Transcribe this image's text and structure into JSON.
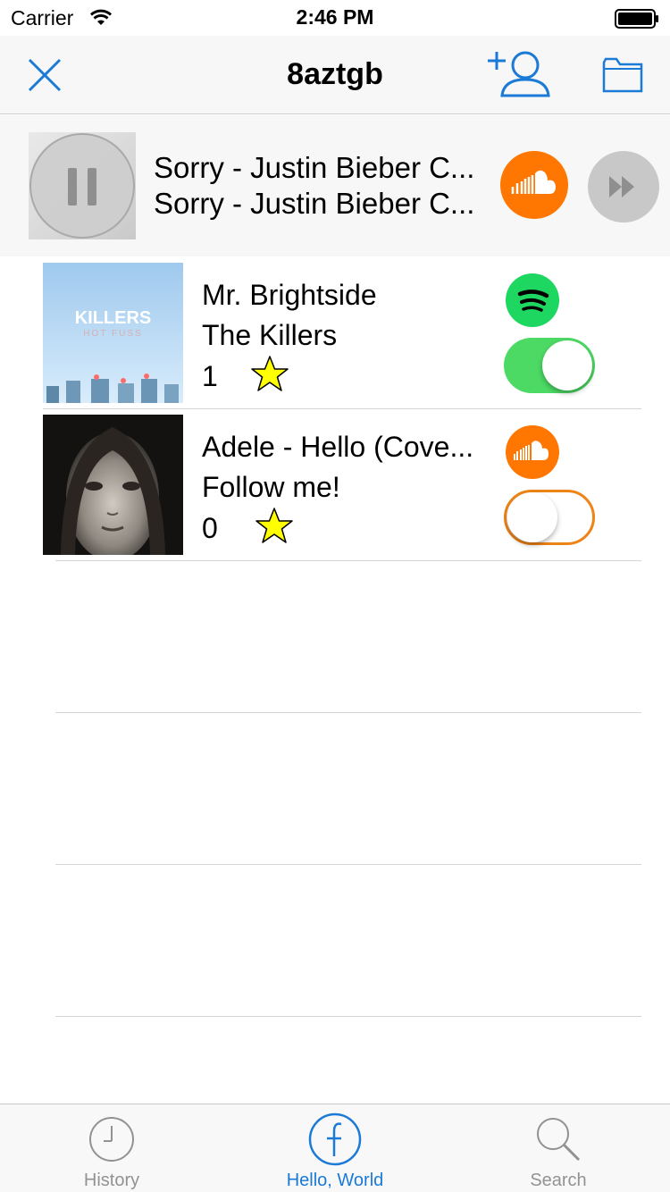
{
  "status_bar": {
    "carrier": "Carrier",
    "time": "2:46 PM"
  },
  "nav": {
    "title": "8aztgb",
    "close_icon": "close-icon",
    "add_user_icon": "add-user-icon",
    "folder_icon": "folder-icon"
  },
  "now_playing": {
    "title": "Sorry - Justin Bieber C...",
    "subtitle": "Sorry - Justin Bieber C...",
    "service_icon": "soundcloud-icon",
    "state": "playing"
  },
  "tracks": [
    {
      "title": "Mr. Brightside",
      "artist": "The Killers",
      "votes": "1",
      "service": "spotify",
      "enabled": true,
      "art_text": "KILLERS",
      "art_subtext": "HOT FUSS"
    },
    {
      "title": "Adele - Hello (Cove...",
      "artist": "Follow me!",
      "votes": "0",
      "service": "soundcloud",
      "enabled": false
    }
  ],
  "tabs": [
    {
      "label": "History",
      "icon": "clock-icon",
      "active": false
    },
    {
      "label": "Hello, World",
      "icon": "f-logo-icon",
      "active": true
    },
    {
      "label": "Search",
      "icon": "search-icon",
      "active": false
    }
  ],
  "colors": {
    "accent": "#1a7ad6",
    "soundcloud": "#ff7700",
    "spotify": "#1ed760",
    "toggle_on": "#4cd964",
    "toggle_off_border": "#ef8416",
    "star": "#ffff00"
  }
}
